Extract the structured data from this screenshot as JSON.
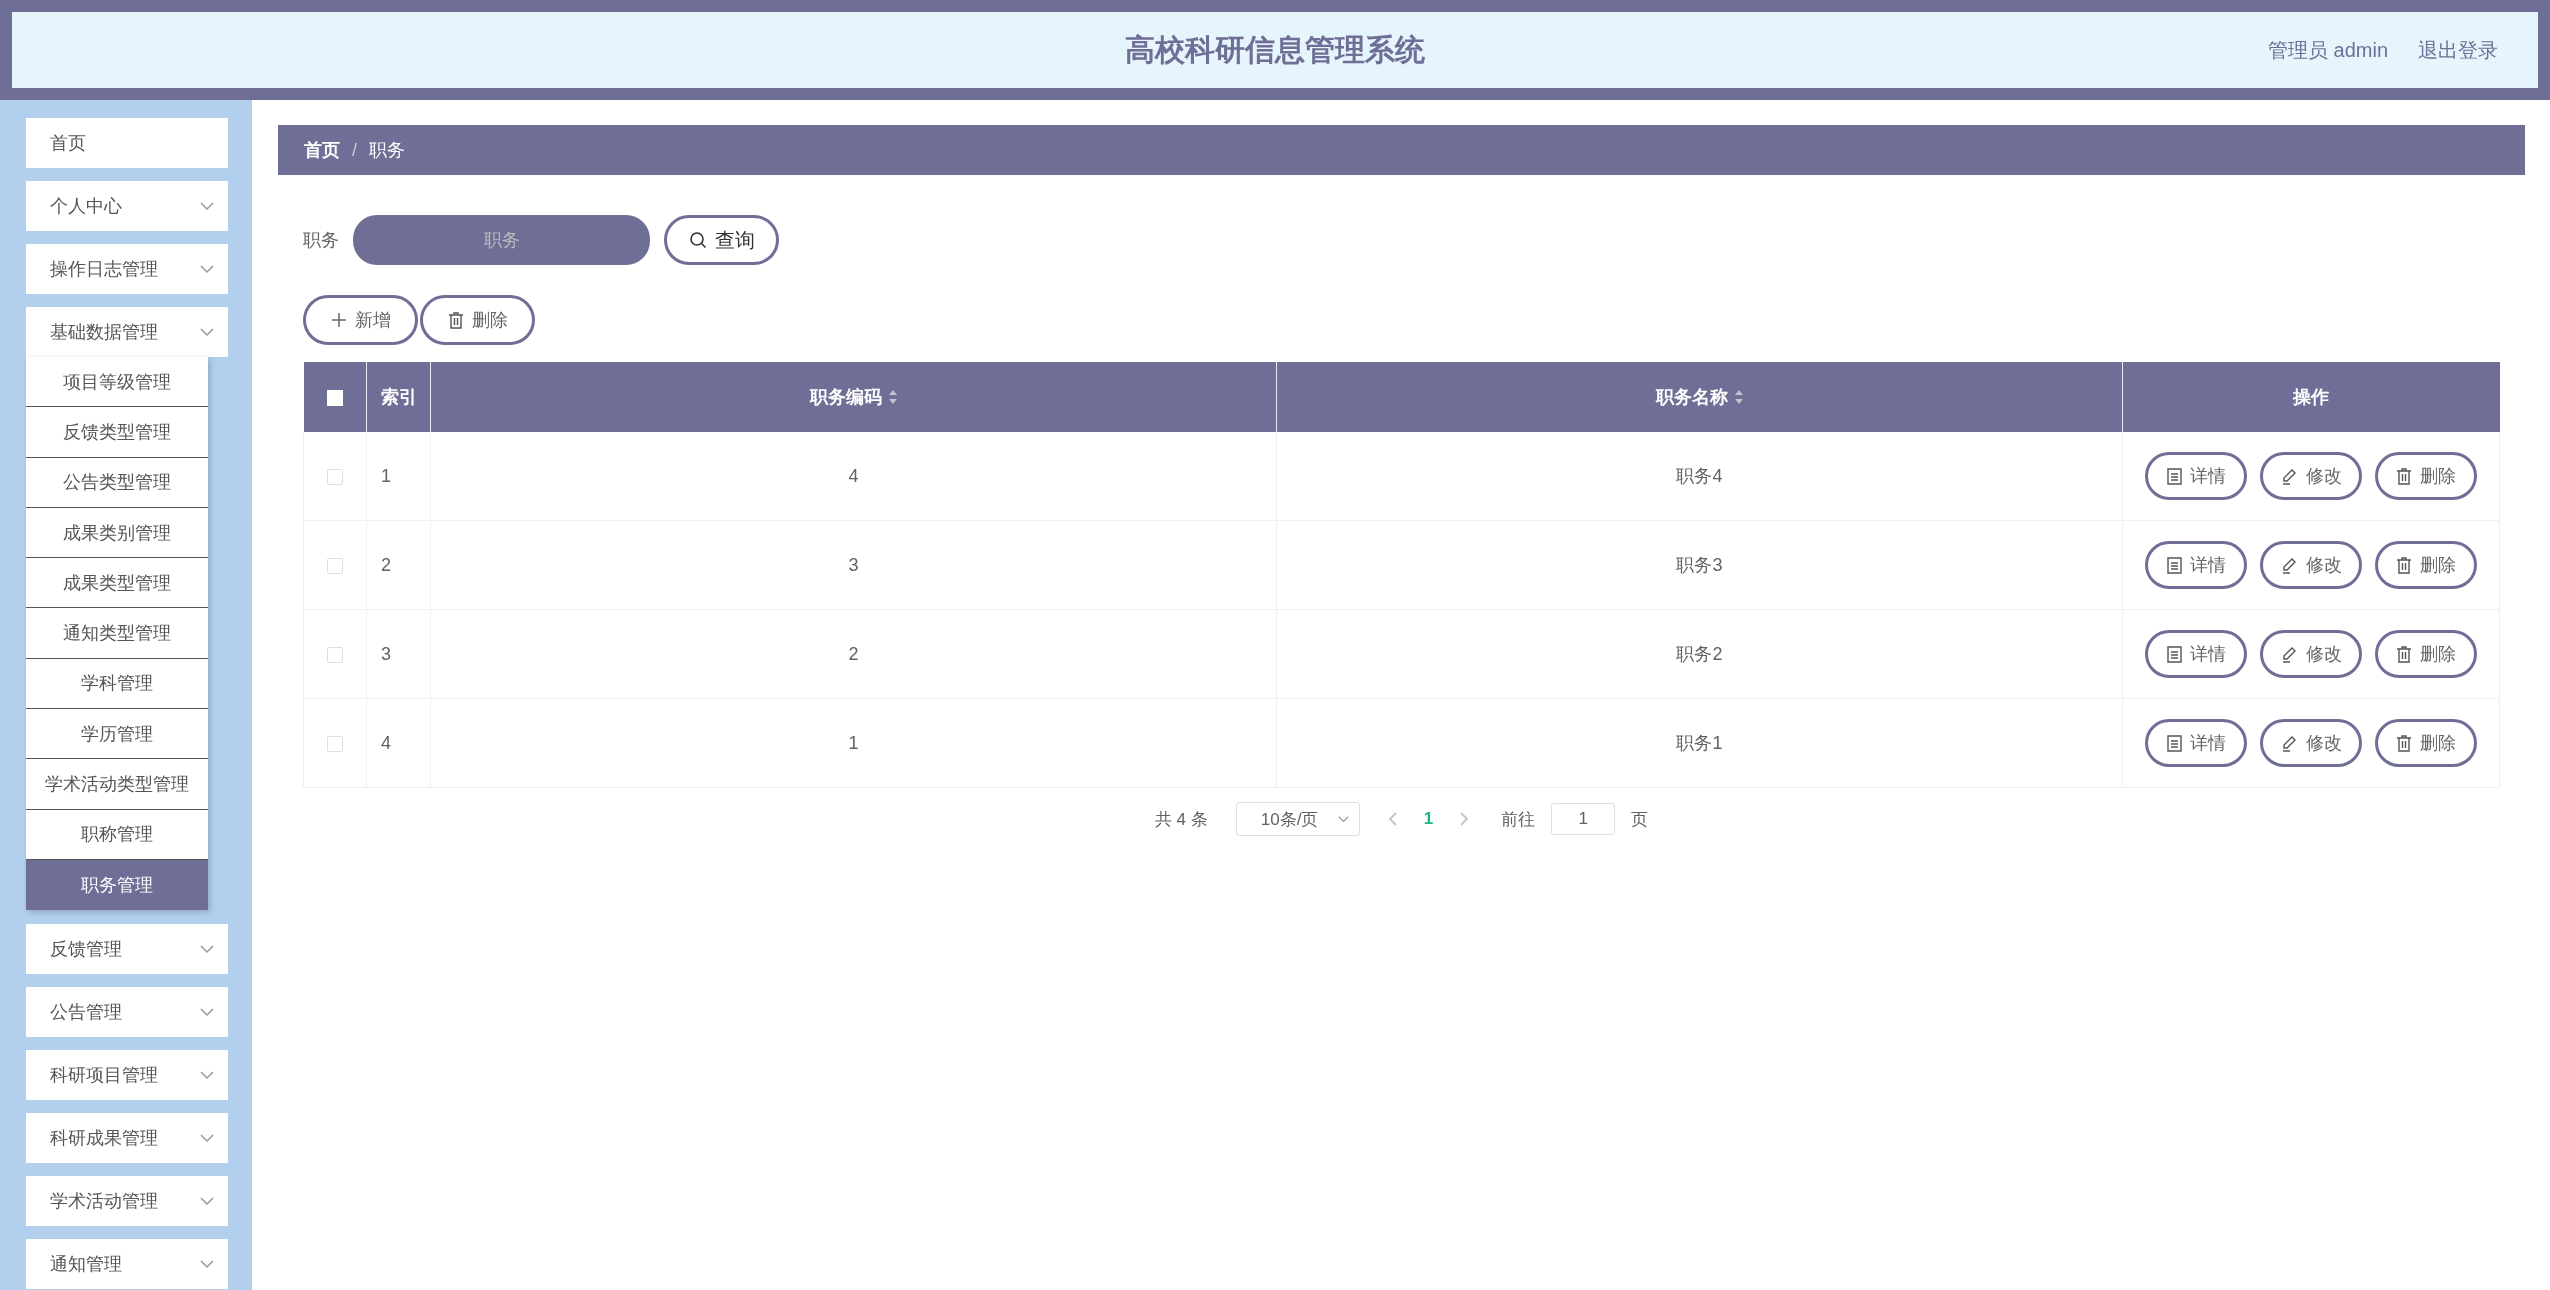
{
  "header": {
    "title": "高校科研信息管理系统",
    "user": "管理员 admin",
    "logout": "退出登录"
  },
  "sidebar": {
    "items": [
      {
        "kind": "link",
        "label": "首页",
        "selected": false
      },
      {
        "kind": "menu",
        "label": "个人中心"
      },
      {
        "kind": "menu",
        "label": "操作日志管理"
      },
      {
        "kind": "menu",
        "label": "基础数据管理",
        "children": [
          {
            "label": "项目等级管理",
            "selected": false
          },
          {
            "label": "反馈类型管理",
            "selected": false
          },
          {
            "label": "公告类型管理",
            "selected": false
          },
          {
            "label": "成果类别管理",
            "selected": false
          },
          {
            "label": "成果类型管理",
            "selected": false
          },
          {
            "label": "通知类型管理",
            "selected": false
          },
          {
            "label": "学科管理",
            "selected": false
          },
          {
            "label": "学历管理",
            "selected": false
          },
          {
            "label": "学术活动类型管理",
            "selected": false
          },
          {
            "label": "职称管理",
            "selected": false
          },
          {
            "label": "职务管理",
            "selected": true
          }
        ]
      },
      {
        "kind": "menu",
        "label": "反馈管理"
      },
      {
        "kind": "menu",
        "label": "公告管理"
      },
      {
        "kind": "menu",
        "label": "科研项目管理"
      },
      {
        "kind": "menu",
        "label": "科研成果管理"
      },
      {
        "kind": "menu",
        "label": "学术活动管理"
      },
      {
        "kind": "menu",
        "label": "通知管理"
      }
    ]
  },
  "breadcrumb": {
    "items": [
      "首页",
      "职务"
    ],
    "separator": "/"
  },
  "search": {
    "label": "职务",
    "placeholder": "职务",
    "button": "查询"
  },
  "actions": [
    {
      "kind": "add",
      "label": "新增"
    },
    {
      "kind": "delete",
      "label": "删除"
    }
  ],
  "table": {
    "select_all_checked": false,
    "columns": [
      {
        "label": "索引",
        "sortable": false
      },
      {
        "label": "职务编码",
        "sortable": true
      },
      {
        "label": "职务名称",
        "sortable": true
      },
      {
        "label": "操作",
        "sortable": false
      }
    ],
    "rows": [
      {
        "checked": false,
        "cells": [
          "1",
          "4",
          "职务4"
        ],
        "actions": [
          {
            "kind": "detail",
            "label": "详情"
          },
          {
            "kind": "edit",
            "label": "修改"
          },
          {
            "kind": "delete",
            "label": "删除"
          }
        ]
      },
      {
        "checked": false,
        "cells": [
          "2",
          "3",
          "职务3"
        ],
        "actions": [
          {
            "kind": "detail",
            "label": "详情"
          },
          {
            "kind": "edit",
            "label": "修改"
          },
          {
            "kind": "delete",
            "label": "删除"
          }
        ]
      },
      {
        "checked": false,
        "cells": [
          "3",
          "2",
          "职务2"
        ],
        "actions": [
          {
            "kind": "detail",
            "label": "详情"
          },
          {
            "kind": "edit",
            "label": "修改"
          },
          {
            "kind": "delete",
            "label": "删除"
          }
        ]
      },
      {
        "checked": false,
        "cells": [
          "4",
          "1",
          "职务1"
        ],
        "actions": [
          {
            "kind": "detail",
            "label": "详情"
          },
          {
            "kind": "edit",
            "label": "修改"
          },
          {
            "kind": "delete",
            "label": "删除"
          }
        ]
      }
    ]
  },
  "pagination": {
    "total": "共 4 条",
    "page_size": "10条/页",
    "pages": [
      {
        "label": "1",
        "selected": true
      }
    ],
    "goto_label": "前往",
    "goto_value": "1",
    "goto_suffix": "页"
  }
}
